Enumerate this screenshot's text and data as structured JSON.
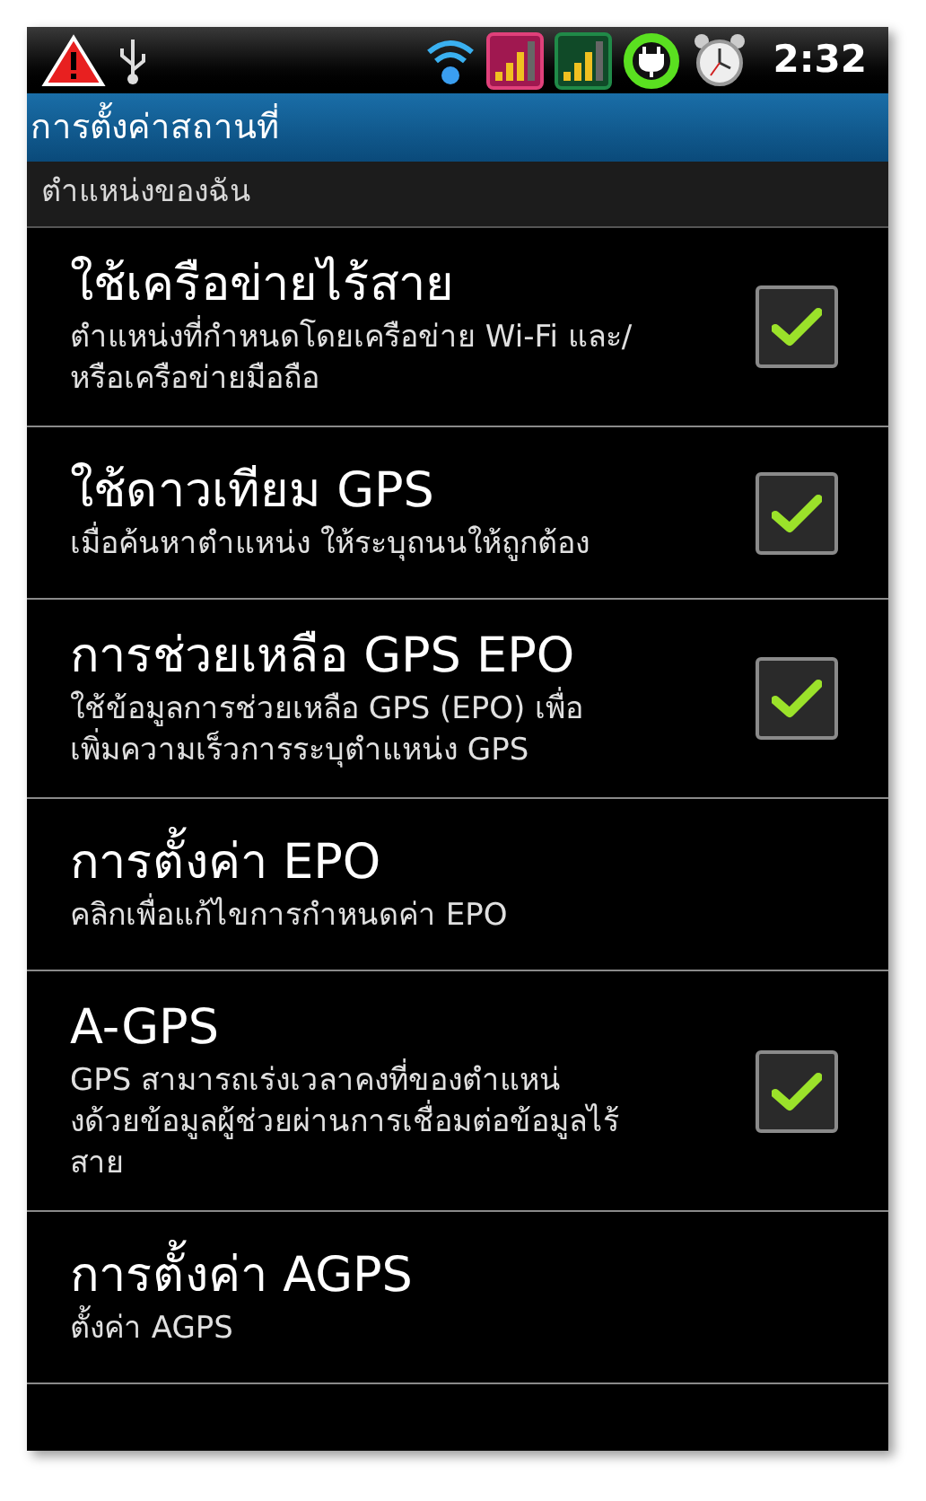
{
  "status_bar": {
    "time": "2:32"
  },
  "title_bar": {
    "title": "การตั้งค่าสถานที่"
  },
  "category": {
    "title": "ตำแหน่งของฉัน"
  },
  "items": [
    {
      "kind": "checkbox",
      "title": "ใช้เครือข่ายไร้สาย",
      "summary": "ตำแหน่งที่กำหนดโดยเครือข่าย Wi-Fi และ/\nหรือเครือข่ายมือถือ",
      "checked": true
    },
    {
      "kind": "checkbox",
      "title": "ใช้ดาวเทียม GPS",
      "summary": "เมื่อค้นหาตำแหน่ง ให้ระบุถนนให้ถูกต้อง",
      "checked": true
    },
    {
      "kind": "checkbox",
      "title": "การช่วยเหลือ GPS EPO",
      "summary": "ใช้ข้อมูลการช่วยเหลือ GPS (EPO) เพื่อ\nเพิ่มความเร็วการระบุตำแหน่ง GPS",
      "checked": true
    },
    {
      "kind": "plain",
      "title": "การตั้งค่า EPO",
      "summary": "คลิกเพื่อแก้ไขการกำหนดค่า EPO"
    },
    {
      "kind": "checkbox",
      "title": "A-GPS",
      "summary": "GPS สามารถเร่งเวลาคงที่ของตำแหน่\nงด้วยข้อมูลผู้ช่วยผ่านการเชื่อมต่อข้อมูลไร้\nสาย",
      "checked": true
    },
    {
      "kind": "plain",
      "title": "การตั้งค่า AGPS",
      "summary": "ตั้งค่า AGPS"
    }
  ]
}
